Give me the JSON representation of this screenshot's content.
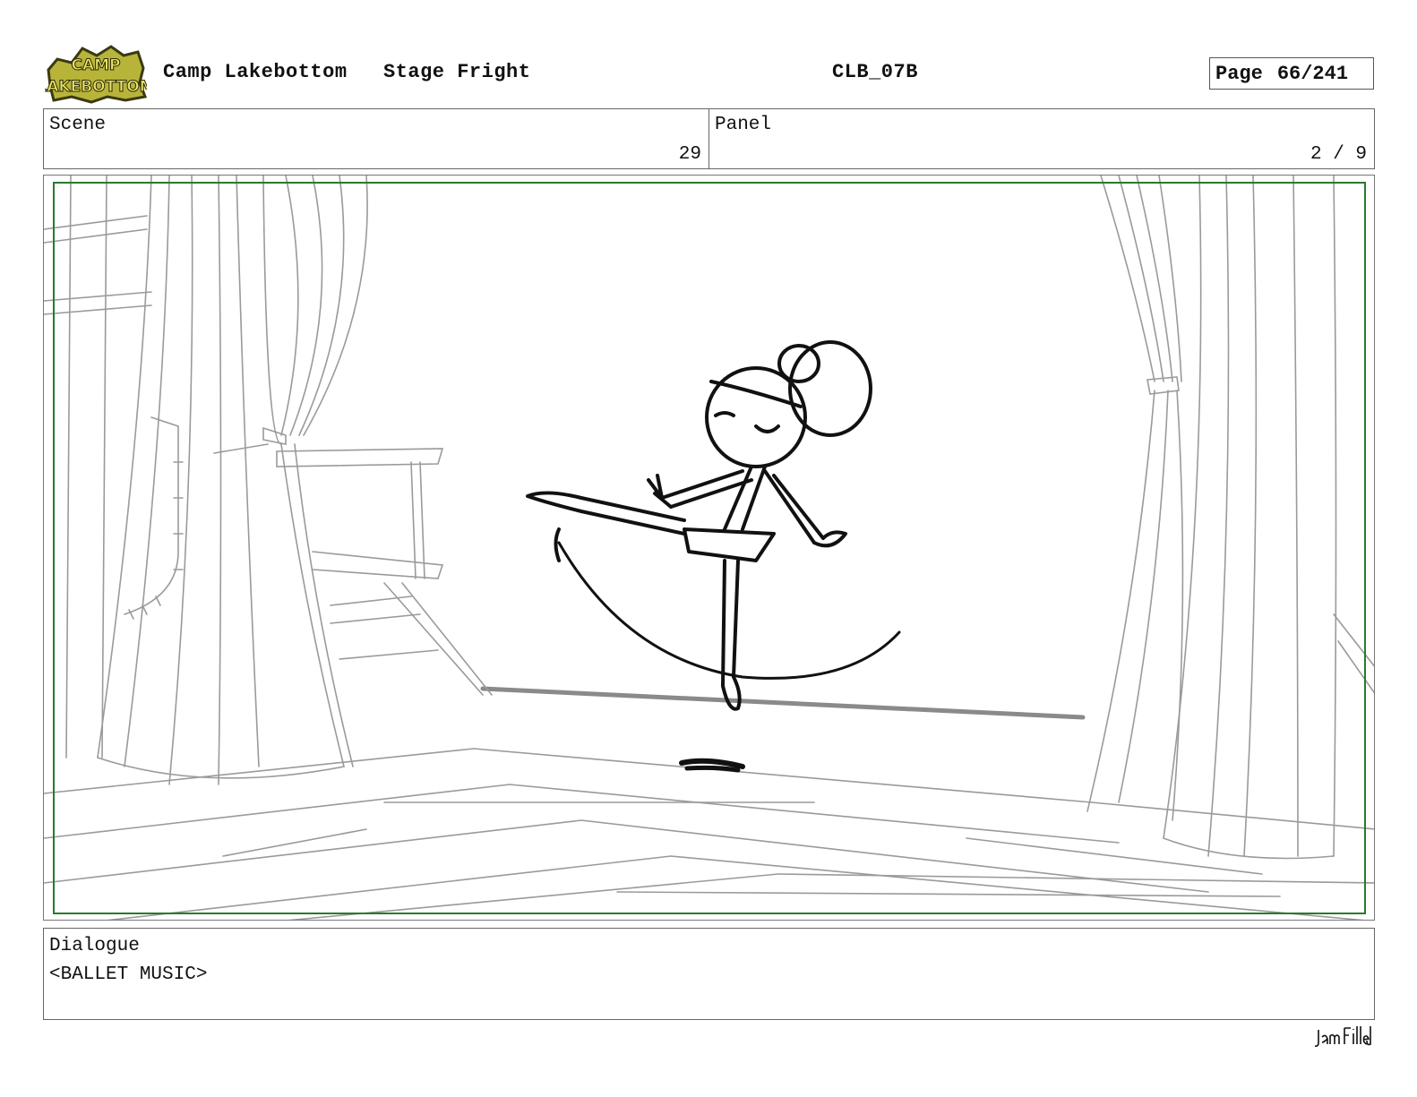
{
  "header": {
    "logo_text": "CAMP LAKEBOTTOM",
    "show_title": "Camp Lakebottom",
    "episode_title": "Stage Fright",
    "episode_code": "CLB_07B",
    "page_label": "Page",
    "page_value": "66/241"
  },
  "info": {
    "scene_label": "Scene",
    "scene_value": "29",
    "panel_label": "Panel",
    "panel_value": "2 / 9"
  },
  "panel_image": {
    "description_icon": "storyboard-sketch-ballerina-stage",
    "safe_frame_color": "#2a7a2a"
  },
  "dialogue": {
    "label": "Dialogue",
    "text": "<BALLET MUSIC>"
  },
  "footer": {
    "studio_signature": "JamFilled"
  }
}
